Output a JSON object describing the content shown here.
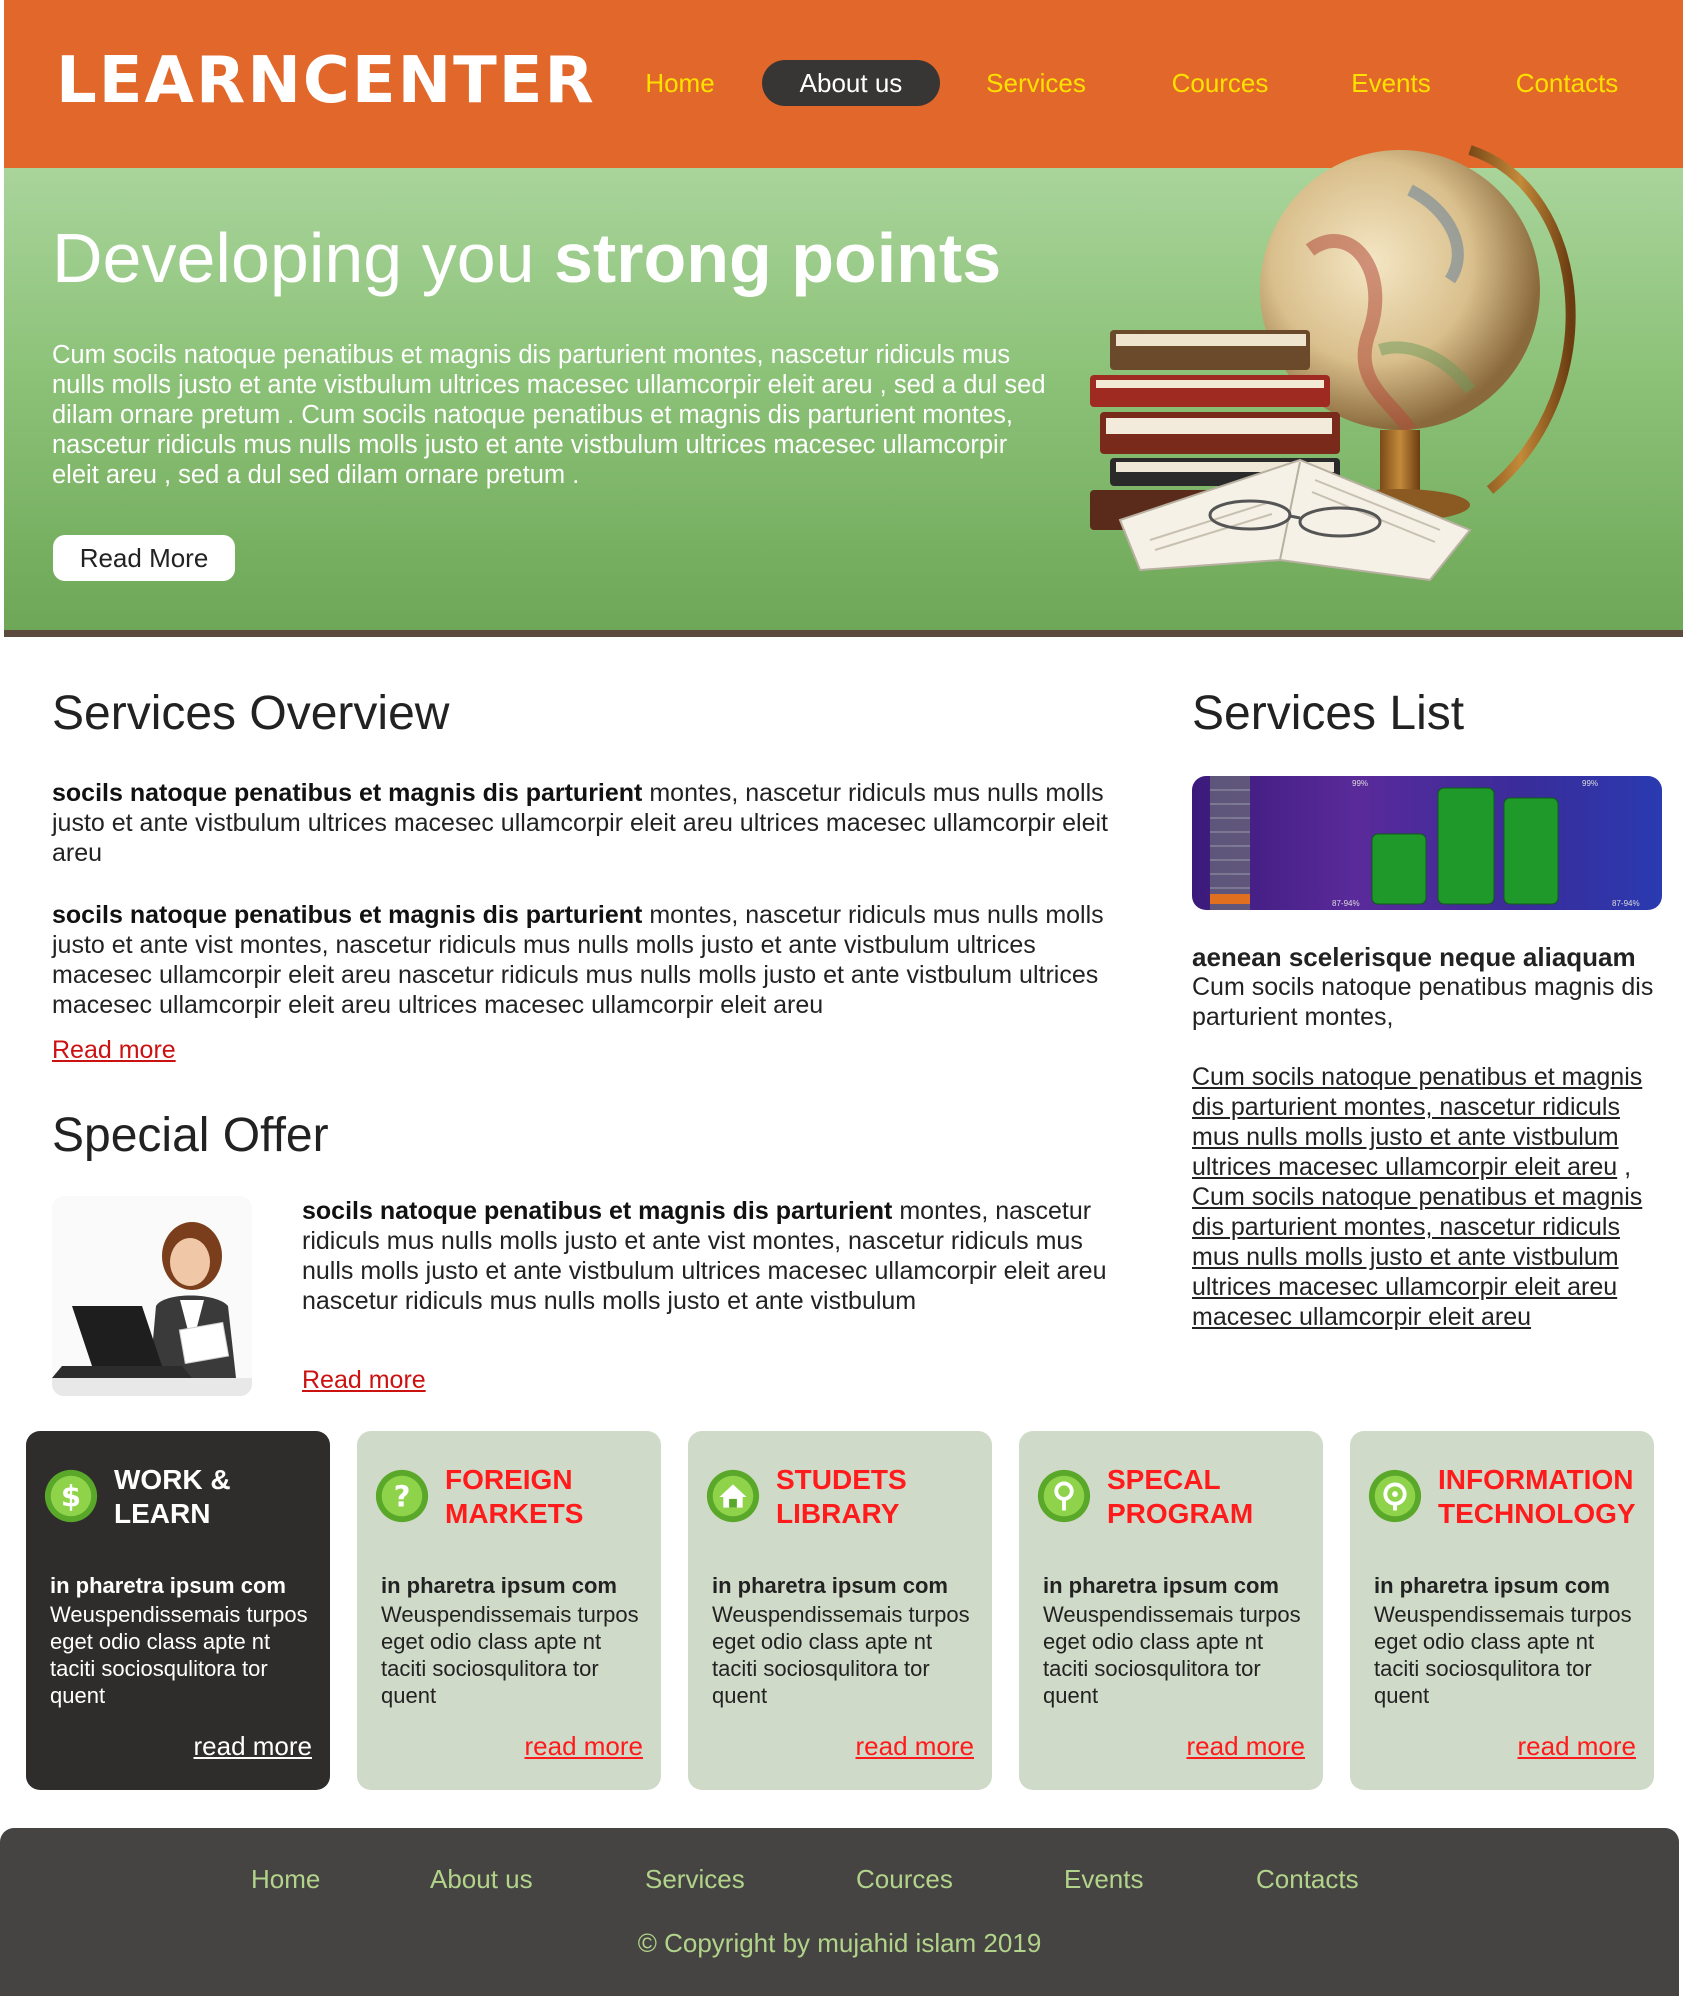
{
  "brand": {
    "logo": "LEARNCENTER"
  },
  "nav": {
    "items": [
      "Home",
      "About us",
      "Services",
      "Cources",
      "Events",
      "Contacts"
    ],
    "active": "About us"
  },
  "hero": {
    "title_normal": "Developing you ",
    "title_bold": "strong points",
    "text": "Cum socils natoque penatibus et magnis dis parturient montes, nascetur ridiculs mus nulls molls justo et ante vistbulum ultrices macesec ullamcorpir eleit areu , sed a dul sed dilam ornare pretum . Cum socils natoque penatibus et magnis dis parturient montes, nascetur ridiculs mus nulls molls justo et ante vistbulum ultrices macesec ullamcorpir eleit areu , sed a dul sed dilam ornare pretum .",
    "button": "Read More"
  },
  "overview": {
    "title": "Services Overview",
    "p1_bold": "socils natoque penatibus et magnis dis parturient",
    "p1_rest": " montes, nascetur ridiculs mus nulls molls justo et ante vistbulum ultrices macesec ullamcorpir eleit areu ultrices macesec ullamcorpir eleit areu",
    "p2_bold": "socils natoque penatibus et magnis dis parturient",
    "p2_rest": " montes, nascetur ridiculs mus nulls molls justo et ante vist montes, nascetur ridiculs mus nulls molls justo et ante vistbulum ultrices macesec ullamcorpir eleit areu nascetur ridiculs mus nulls molls justo et ante vistbulum ultrices macesec ullamcorpir eleit areu ultrices macesec ullamcorpir eleit areu",
    "link": "Read more"
  },
  "offer": {
    "title": "Special Offer",
    "p_bold": "socils natoque penatibus et magnis dis parturient",
    "p_rest": " montes, nascetur ridiculs mus nulls molls justo et ante vist montes, nascetur ridiculs mus nulls molls justo et ante vistbulum ultrices macesec ullamcorpir eleit areu nascetur ridiculs mus nulls molls justo et ante vistbulum",
    "link": "Read more"
  },
  "services_list": {
    "title": "Services List",
    "thumb_labels": [
      "99%",
      "99%",
      "87-94%",
      "87-94%"
    ],
    "heading": "aenean scelerisque neque aliaquam",
    "text": "Cum socils natoque penatibus magnis dis parturient montes,",
    "link1": "Cum socils natoque penatibus et magnis dis parturient montes, nascetur ridiculs mus nulls molls justo et ante vistbulum ultrices macesec ullamcorpir eleit areu",
    "link1_suffix": " ,",
    "link2": "Cum socils natoque penatibus et magnis dis parturient montes, nascetur ridiculs mus nulls molls justo et ante vistbulum ultrices macesec ullamcorpir eleit areu macesec ullamcorpir eleit areu"
  },
  "boxes": [
    {
      "title1": "WORK &",
      "title2": "LEARN",
      "icon": "dollar-icon",
      "sub": "in pharetra ipsum com",
      "text": "Weuspendissemais turpos eget odio class apte nt taciti sociosqulitora tor quent",
      "link": "read more"
    },
    {
      "title1": "FOREIGN",
      "title2": "MARKETS",
      "icon": "question-icon",
      "sub": "in pharetra ipsum com",
      "text": "Weuspendissemais turpos eget odio class apte nt taciti sociosqulitora tor quent",
      "link": "read more"
    },
    {
      "title1": "STUDETS",
      "title2": "LIBRARY",
      "icon": "home-icon",
      "sub": "in pharetra ipsum com",
      "text": "Weuspendissemais turpos eget odio class apte nt taciti sociosqulitora tor quent",
      "link": "read more"
    },
    {
      "title1": "SPECAL",
      "title2": "PROGRAM",
      "icon": "pin-icon",
      "sub": "in pharetra ipsum com",
      "text": "Weuspendissemais turpos eget odio class apte nt taciti sociosqulitora tor quent",
      "link": "read more"
    },
    {
      "title1": "INFORMATION",
      "title2": "TECHNOLOGY",
      "icon": "target-icon",
      "sub": "in pharetra ipsum com",
      "text": "Weuspendissemais turpos eget odio class apte nt taciti sociosqulitora tor quent",
      "link": "read more"
    }
  ],
  "footer": {
    "items": [
      "Home",
      "About us",
      "Services",
      "Cources",
      "Events",
      "Contacts"
    ],
    "copyright": "© Copyright by mujahid islam 2019"
  },
  "colors": {
    "header": "#e2672a",
    "nav_text": "#ffe100",
    "hero_green": "#8cc278",
    "box_bg": "#d0dac8",
    "box_dark": "#2f2d2c",
    "accent_red": "#ff1b1b",
    "footer_bg": "#464443",
    "footer_text": "#b2d48a"
  }
}
